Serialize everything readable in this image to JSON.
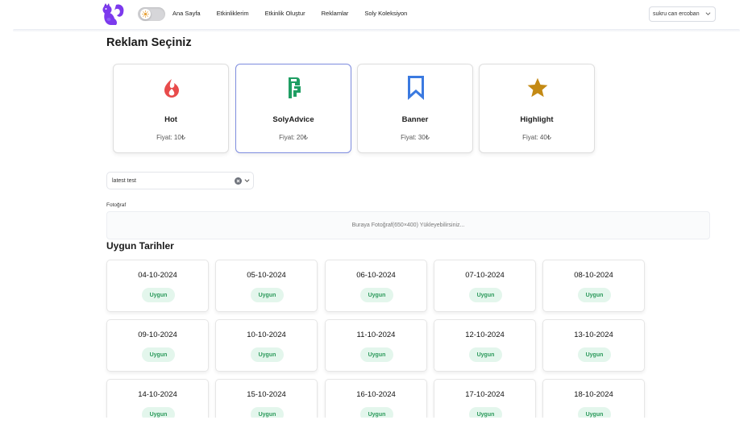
{
  "nav": {
    "links": [
      "Ana Sayfa",
      "Etkinliklerim",
      "Etkinlik Oluştur",
      "Reklamlar",
      "Soly Koleksiyon"
    ],
    "user": "sukru can ercoban"
  },
  "page_title": "Reklam Seçiniz",
  "ad_types": [
    {
      "name": "Hot",
      "price": "Fiyat: 10₺",
      "icon": "flame-icon",
      "color": "#e84b4b"
    },
    {
      "name": "SolyAdvice",
      "price": "Fiyat: 20₺",
      "icon": "advice-icon",
      "color": "#1f9e63",
      "selected": true
    },
    {
      "name": "Banner",
      "price": "Fiyat: 30₺",
      "icon": "bookmark-icon",
      "color": "#3b7ae0"
    },
    {
      "name": "Highlight",
      "price": "Fiyat: 40₺",
      "icon": "star-icon",
      "color": "#c48a14"
    }
  ],
  "event_select": {
    "value": "latest test"
  },
  "photo": {
    "label": "Fotoğraf",
    "placeholder": "Buraya Fotoğraf(650×400) Yükleyebilirsiniz..."
  },
  "dates_title": "Uygun Tarihler",
  "dates": [
    {
      "date": "04-10-2024",
      "status": "Uygun"
    },
    {
      "date": "05-10-2024",
      "status": "Uygun"
    },
    {
      "date": "06-10-2024",
      "status": "Uygun"
    },
    {
      "date": "07-10-2024",
      "status": "Uygun"
    },
    {
      "date": "08-10-2024",
      "status": "Uygun"
    },
    {
      "date": "09-10-2024",
      "status": "Uygun"
    },
    {
      "date": "10-10-2024",
      "status": "Uygun"
    },
    {
      "date": "11-10-2024",
      "status": "Uygun"
    },
    {
      "date": "12-10-2024",
      "status": "Uygun"
    },
    {
      "date": "13-10-2024",
      "status": "Uygun"
    },
    {
      "date": "14-10-2024",
      "status": "Uygun"
    },
    {
      "date": "15-10-2024",
      "status": "Uygun"
    },
    {
      "date": "16-10-2024",
      "status": "Uygun"
    },
    {
      "date": "17-10-2024",
      "status": "Uygun"
    },
    {
      "date": "18-10-2024",
      "status": "Uygun"
    }
  ],
  "colors": {
    "accent": "#7c3aed",
    "selected_border": "#7f8de0",
    "badge_bg": "#e3f6ec",
    "badge_text": "#2d9a5c"
  }
}
